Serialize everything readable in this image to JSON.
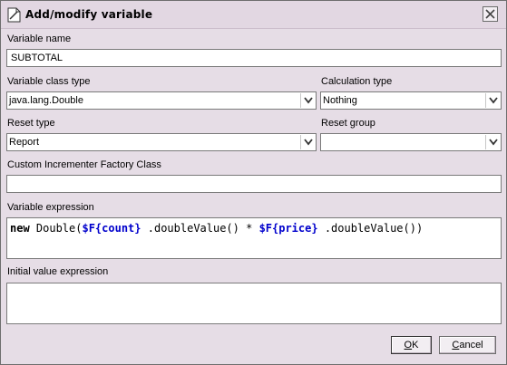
{
  "window": {
    "title": "Add/modify variable",
    "icon": "document-icon"
  },
  "form": {
    "variable_name_label": "Variable name",
    "variable_name_value": "SUBTOTAL",
    "class_type_label": "Variable class type",
    "class_type_value": "java.lang.Double",
    "calc_type_label": "Calculation type",
    "calc_type_value": "Nothing",
    "reset_type_label": "Reset type",
    "reset_type_value": "Report",
    "reset_group_label": "Reset group",
    "reset_group_value": "",
    "incrementer_label": "Custom Incrementer Factory Class",
    "incrementer_value": "",
    "expression_label": "Variable expression",
    "expression": {
      "kw_new": "new",
      "part1": " Double(",
      "field1": "$F{count}",
      "part2": " .doubleValue() * ",
      "field2": "$F{price}",
      "part3": " .doubleValue())"
    },
    "initial_label": "Initial value expression",
    "initial_value": ""
  },
  "buttons": {
    "ok_label": "OK",
    "ok_mnemonic": "O",
    "ok_rest": "K",
    "cancel_label": "Cancel",
    "cancel_mnemonic": "C",
    "cancel_rest": "ancel"
  },
  "colors": {
    "field_reference": "#0000cc",
    "dialog_background": "#e6dde6"
  }
}
